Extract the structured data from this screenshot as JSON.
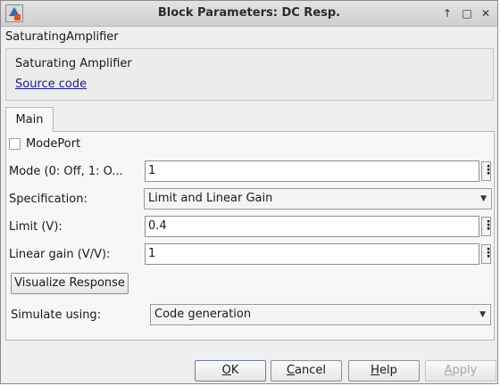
{
  "window": {
    "title": "Block Parameters: DC Resp."
  },
  "block": {
    "name": "SaturatingAmplifier",
    "description_title": "Saturating Amplifier",
    "source_link": "Source code"
  },
  "tabs": {
    "main": "Main"
  },
  "params": {
    "modeport_label": "ModePort",
    "modeport_checked": false,
    "mode_label": "Mode (0: Off, 1: O...",
    "mode_value": "1",
    "spec_label": "Specification:",
    "spec_value": "Limit and Linear Gain",
    "limit_label": "Limit (V):",
    "limit_value": "0.4",
    "gain_label": "Linear gain (V/V):",
    "gain_value": "1",
    "visualize_label": "Visualize Response",
    "simulate_label": "Simulate using:",
    "simulate_value": "Code generation"
  },
  "buttons": {
    "ok": {
      "prefix": "",
      "mnemonic": "O",
      "suffix": "K"
    },
    "cancel": {
      "prefix": "",
      "mnemonic": "C",
      "suffix": "ancel"
    },
    "help": {
      "prefix": "",
      "mnemonic": "H",
      "suffix": "elp"
    },
    "apply": {
      "prefix": "",
      "mnemonic": "A",
      "suffix": "pply"
    }
  },
  "icons": {
    "app": "simulink-block-icon",
    "restore": "up-arrow-icon",
    "maximize": "maximize-icon",
    "close": "close-icon",
    "more": "ellipsis-icon",
    "dropdown": "chevron-down-icon"
  }
}
